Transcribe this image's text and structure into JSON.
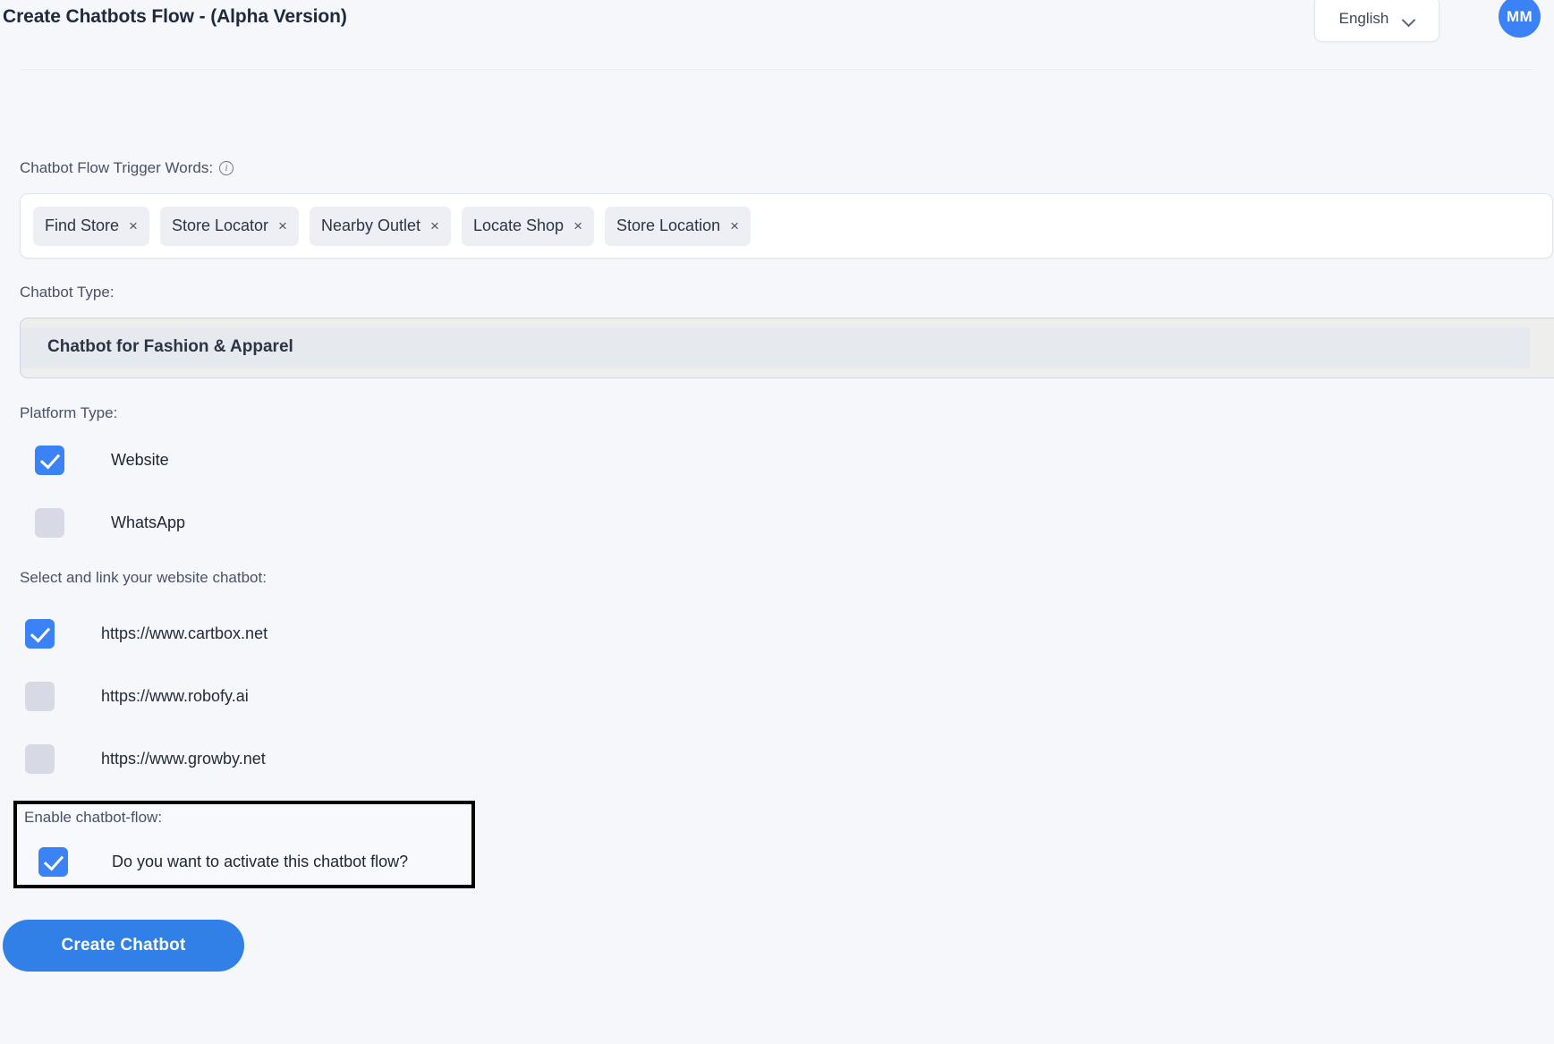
{
  "header": {
    "title": "Create Chatbots Flow - (Alpha Version)",
    "language": "English",
    "avatar_initials": "MM"
  },
  "trigger_words": {
    "label": "Chatbot Flow Trigger Words:",
    "info_icon_glyph": "i",
    "tags": [
      {
        "label": "Find Store",
        "remove_glyph": "×"
      },
      {
        "label": "Store Locator",
        "remove_glyph": "×"
      },
      {
        "label": "Nearby Outlet",
        "remove_glyph": "×"
      },
      {
        "label": "Locate Shop",
        "remove_glyph": "×"
      },
      {
        "label": "Store Location",
        "remove_glyph": "×"
      }
    ]
  },
  "chatbot_type": {
    "label": "Chatbot Type:",
    "value": "Chatbot for Fashion & Apparel"
  },
  "platform_type": {
    "label": "Platform Type:",
    "options": [
      {
        "label": "Website",
        "checked": true
      },
      {
        "label": "WhatsApp",
        "checked": false
      }
    ]
  },
  "website_chatbot": {
    "label": "Select and link your website chatbot:",
    "options": [
      {
        "label": "https://www.cartbox.net",
        "checked": true
      },
      {
        "label": "https://www.robofy.ai",
        "checked": false
      },
      {
        "label": "https://www.growby.net",
        "checked": false
      }
    ]
  },
  "enable_flow": {
    "label": "Enable chatbot-flow:",
    "checkbox_label": "Do you want to activate this chatbot flow?",
    "checked": true
  },
  "actions": {
    "create_button": "Create Chatbot"
  },
  "colors": {
    "accent": "#3b82f6",
    "button": "#3180e8",
    "page_bg": "#f6f7fb",
    "checkbox_unchecked": "#d7dae4",
    "highlight_border": "#000000"
  }
}
